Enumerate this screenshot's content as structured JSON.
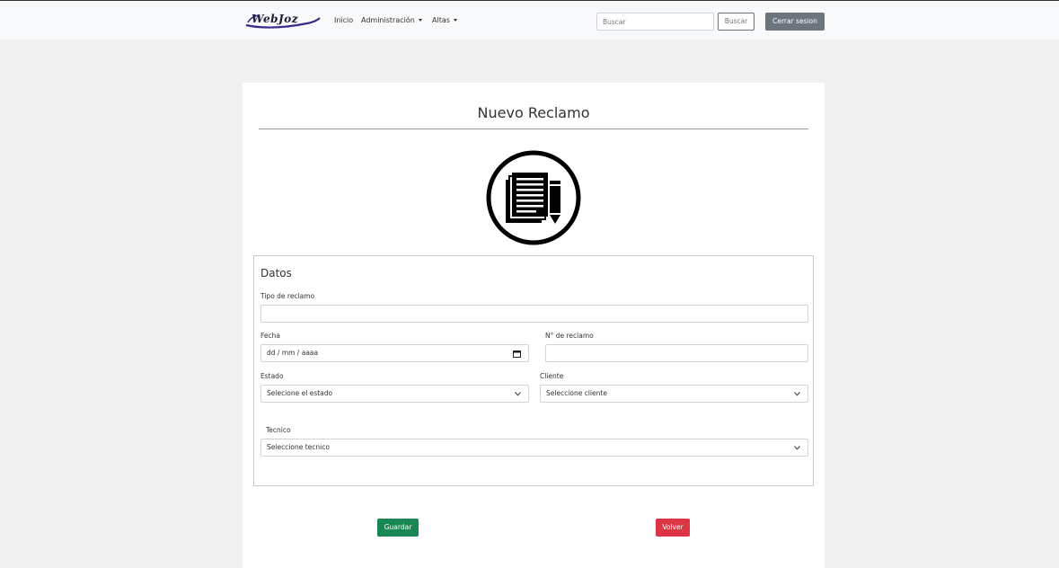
{
  "brand": {
    "logo_text": "WebJoz"
  },
  "nav": {
    "inicio": "Inicio",
    "administracion": "Administración",
    "altas": "Altas"
  },
  "search": {
    "placeholder": "Buscar",
    "button_label": "Buscar"
  },
  "logout_label": "Cerrar sesion",
  "page": {
    "title": "Nuevo Reclamo",
    "emblem_icon": "document-pencil-icon"
  },
  "form": {
    "legend": "Datos",
    "tipo_label": "Tipo de reclamo",
    "tipo_value": "",
    "fecha_label": "Fecha",
    "fecha_placeholder": "dd / mm / aaaa",
    "numero_label": "N° de reclamo",
    "numero_value": "",
    "estado_label": "Estado",
    "estado_selected": "Selecione el estado",
    "cliente_label": "Cliente",
    "cliente_selected": "Seleccione cliente",
    "tecnico_label": "Tecnico",
    "tecnico_selected": "Seleccione tecnico"
  },
  "actions": {
    "save_label": "Guardar",
    "back_label": "Volver"
  },
  "colors": {
    "navbar_bg": "#f8f9fa",
    "page_bg": "#f0f0f0",
    "secondary": "#6c757d",
    "success": "#198754",
    "danger": "#dc3545"
  }
}
